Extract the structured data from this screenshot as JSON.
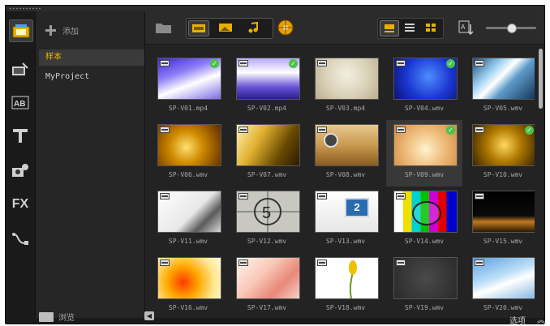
{
  "library": {
    "add_label": "添加",
    "folders": [
      {
        "label": "样本",
        "selected": true
      },
      {
        "label": "MyProject",
        "selected": false
      }
    ]
  },
  "bottom": {
    "browse_label": "浏览",
    "options_label": "选项"
  },
  "colors": {
    "accent_yellow": "#f2b600",
    "check_green": "#4cc24c",
    "panel_bg": "#202020"
  },
  "toolbar": {
    "icons": [
      "open-folder-icon",
      "video-filter-icon",
      "photo-filter-icon",
      "audio-filter-icon",
      "media-library-icon",
      "large-thumbnail-icon",
      "list-view-icon",
      "grid-view-icon",
      "sort-icon",
      "zoom-slider"
    ],
    "zoom_level": 0.5
  },
  "media": [
    {
      "name": "SP-V01.mp4",
      "checked": true
    },
    {
      "name": "SP-V02.mp4",
      "checked": true
    },
    {
      "name": "SP-V03.mp4",
      "checked": false
    },
    {
      "name": "SP-V04.wmv",
      "checked": true
    },
    {
      "name": "SP-V05.wmv",
      "checked": false
    },
    {
      "name": "SP-V06.wmv",
      "checked": false
    },
    {
      "name": "SP-V07.wmv",
      "checked": false
    },
    {
      "name": "SP-V08.wmv",
      "checked": false
    },
    {
      "name": "SP-V09.wmv",
      "checked": true
    },
    {
      "name": "SP-V10.wmv",
      "checked": true
    },
    {
      "name": "SP-V11.wmv",
      "checked": false
    },
    {
      "name": "SP-V12.wmv",
      "checked": false
    },
    {
      "name": "SP-V13.wmv",
      "checked": false
    },
    {
      "name": "SP-V14.wmv",
      "checked": false
    },
    {
      "name": "SP-V15.wmv",
      "checked": false
    },
    {
      "name": "SP-V16.wmv",
      "checked": false
    },
    {
      "name": "SP-V17.wmv",
      "checked": false
    },
    {
      "name": "SP-V18.wmv",
      "checked": false
    },
    {
      "name": "SP-V19.wmv",
      "checked": false
    },
    {
      "name": "SP-V20.wmv",
      "checked": false
    }
  ]
}
